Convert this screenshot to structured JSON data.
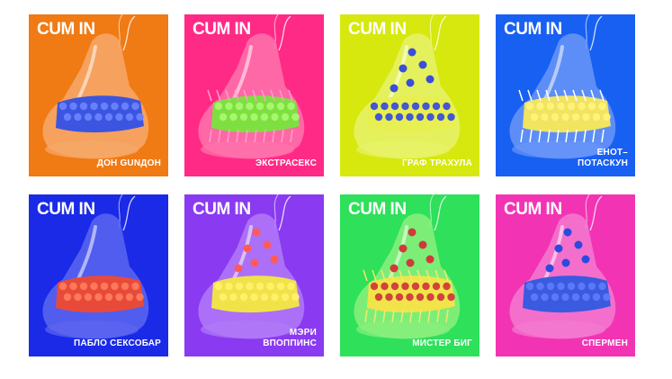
{
  "brand": "CUM IN",
  "cards": [
    {
      "name": "ДОН GUNДОН",
      "bg": "#f07a14",
      "body": "#f7a86a",
      "band": "#3c55e0",
      "bump": "#6a82ff",
      "spikes": "none"
    },
    {
      "name": "ЭКСТРАСЕКС",
      "bg": "#ff2a86",
      "body": "#ff73ad",
      "band": "#7ee040",
      "bump": "#a8f870",
      "spikes": "pink"
    },
    {
      "name": "ГРАФ ТРАХУЛА",
      "bg": "#d6e80e",
      "body": "#e8f26a",
      "band": "#e8ef50",
      "bump": "#3a4fd8",
      "spikes": "dots"
    },
    {
      "name": "ЕНОТ–\nПОТАСКУН",
      "bg": "#1860f2",
      "body": "#6a96f8",
      "band": "#f0e460",
      "bump": "#fff27a",
      "spikes": "white"
    },
    {
      "name": "ПАБЛО СЕКСОБАР",
      "bg": "#1a2ae6",
      "body": "#5c66f0",
      "band": "#e84a3a",
      "bump": "#ff7a5c",
      "spikes": "none"
    },
    {
      "name": "МЭРИ\nВПОППИНС",
      "bg": "#8a3af0",
      "body": "#b07af8",
      "band": "#f2e24a",
      "bump": "#fff06a",
      "spikes": "balls"
    },
    {
      "name": "МИСТЕР БИГ",
      "bg": "#2ee05a",
      "body": "#8af07e",
      "band": "#f0e44a",
      "bump": "#d03a3a",
      "spikes": "yellow"
    },
    {
      "name": "СПЕРМЕН",
      "bg": "#f234b4",
      "body": "#f47ad0",
      "band": "#3a5ae0",
      "bump": "#5c7af8",
      "spikes": "blue"
    }
  ]
}
